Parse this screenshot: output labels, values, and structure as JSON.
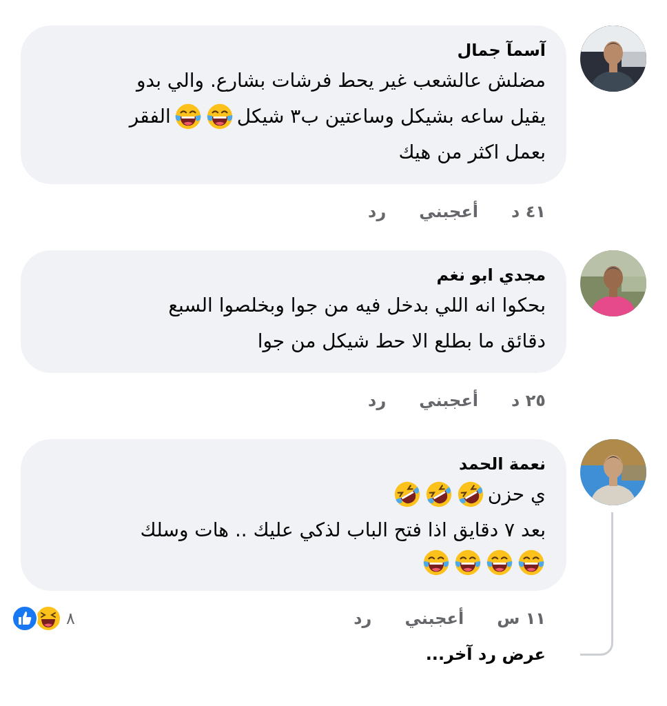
{
  "comments": [
    {
      "author": "آسمآ جمال",
      "avatar": {
        "kind": "picture"
      },
      "lines": [
        [
          {
            "kind": "text",
            "text": "مضلش عالشعب غير يحط فرشات بشارع. والي بدو"
          }
        ],
        [
          {
            "kind": "text",
            "text": "يقيل ساعه بشيكل وساعتين ب٣ شيكل"
          },
          {
            "kind": "joy"
          },
          {
            "kind": "joy"
          },
          {
            "kind": "text",
            "text": "الفقر"
          }
        ],
        [
          {
            "kind": "text",
            "text": "بعمل اكثر من هيك"
          }
        ]
      ],
      "time": "٤١ د",
      "like": "أعجبني",
      "reply": "رد"
    },
    {
      "author": "مجدي ابو نغم",
      "avatar": {
        "kind": "picture"
      },
      "lines": [
        [
          {
            "kind": "text",
            "text": "بحكوا انه اللي بدخل فيه من جوا وبخلصوا السبع"
          }
        ],
        [
          {
            "kind": "text",
            "text": "دقائق ما بطلع الا حط شيكل من جوا"
          }
        ]
      ],
      "time": "٢٥ د",
      "like": "أعجبني",
      "reply": "رد"
    },
    {
      "author": "نعمة الحمد",
      "avatar": {
        "kind": "picture"
      },
      "lines": [
        [
          {
            "kind": "text",
            "text": "ي حزن"
          },
          {
            "kind": "rofl"
          },
          {
            "kind": "rofl"
          },
          {
            "kind": "rofl"
          }
        ],
        [
          {
            "kind": "text",
            "text": "بعد ٧ دقايق اذا فتح الباب لذكي عليك .. هات وسلك"
          }
        ],
        [
          {
            "kind": "joy"
          },
          {
            "kind": "joy"
          },
          {
            "kind": "joy"
          },
          {
            "kind": "joy"
          }
        ]
      ],
      "time": "١١ س",
      "like": "أعجبني",
      "reply": "رد",
      "reactions": {
        "icons": [
          {
            "kind": "like"
          },
          {
            "kind": "haha"
          }
        ],
        "count": "٨"
      },
      "more_replies": "عرض رد آخر..."
    }
  ]
}
